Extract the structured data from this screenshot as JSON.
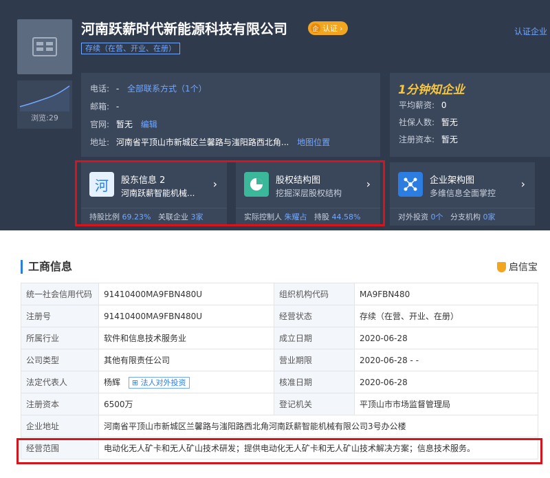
{
  "company": {
    "name": "河南跃薪时代新能源科技有限公司",
    "cert_badge": "认证",
    "cert_link": "认证企业",
    "status_tag": "存续（在营、开业、在册）",
    "views": "浏览:29"
  },
  "contact": {
    "phone_label": "电话:",
    "phone_value": "-",
    "phone_link": "全部联系方式（1个）",
    "email_label": "邮箱:",
    "email_value": "-",
    "website_label": "官网:",
    "website_value": "暂无",
    "website_edit": "编辑",
    "address_label": "地址:",
    "address_value": "河南省平顶山市新城区兰馨路与滍阳路西北角...",
    "address_link": "地图位置"
  },
  "insight": {
    "brand": "1分钟知企业",
    "rows": [
      {
        "label": "平均薪资:",
        "value": "0"
      },
      {
        "label": "社保人数:",
        "value": "暂无"
      },
      {
        "label": "注册资本:",
        "value": "暂无"
      }
    ]
  },
  "cards": [
    {
      "icon": "河",
      "title": "股东信息 2",
      "subtitle": "河南跃薪智能机械...",
      "foot1_label": "持股比例",
      "foot1_value": "69.23%",
      "foot2_label": "关联企业",
      "foot2_value": "3家"
    },
    {
      "title": "股权结构图",
      "subtitle": "挖掘深层股权结构",
      "foot1_label": "实际控制人",
      "foot1_value": "朱耀占",
      "foot2_label": "持股",
      "foot2_value": "44.58%"
    },
    {
      "title": "企业架构图",
      "subtitle": "多维信息全面掌控",
      "foot1_label": "对外投资",
      "foot1_value": "0个",
      "foot2_label": "分支机构",
      "foot2_value": "0家"
    }
  ],
  "section": {
    "title": "工商信息",
    "source": "启信宝"
  },
  "business_info": {
    "credit_code_label": "统一社会信用代码",
    "credit_code": "91410400MA9FBN480U",
    "org_code_label": "组织机构代码",
    "org_code": "MA9FBN480",
    "reg_no_label": "注册号",
    "reg_no": "91410400MA9FBN480U",
    "status_label": "经营状态",
    "status": "存续（在营、开业、在册）",
    "industry_label": "所属行业",
    "industry": "软件和信息技术服务业",
    "founded_label": "成立日期",
    "founded": "2020-06-28",
    "type_label": "公司类型",
    "type": "其他有限责任公司",
    "term_label": "营业期限",
    "term": "2020-06-28 - -",
    "legal_label": "法定代表人",
    "legal": "杨辉",
    "legal_btn": "法人对外投资",
    "approved_label": "核准日期",
    "approved": "2020-06-28",
    "capital_label": "注册资本",
    "capital": "6500万",
    "authority_label": "登记机关",
    "authority": "平顶山市市场监督管理局",
    "address_label": "企业地址",
    "address": "河南省平顶山市新城区兰馨路与滍阳路西北角河南跃薪智能机械有限公司3号办公楼",
    "scope_label": "经营范围",
    "scope": "电动化无人矿卡和无人矿山技术研发；提供电动化无人矿卡和无人矿山技术解决方案；信息技术服务。"
  }
}
